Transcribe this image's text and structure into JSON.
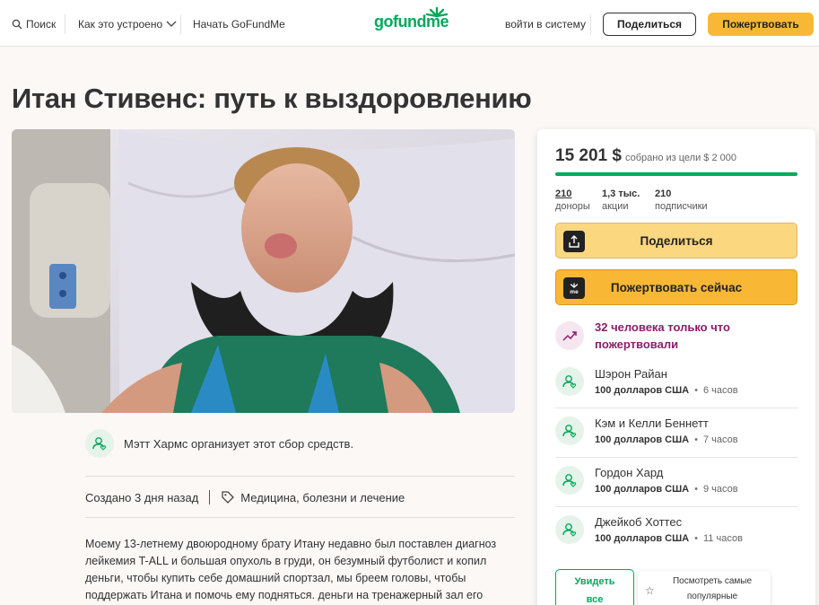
{
  "header": {
    "search": "Поиск",
    "how_it_works": "Как это устроено",
    "start": "Начать GoFundMe",
    "logo": "gofundme",
    "login": "войти в систему",
    "share": "Поделиться",
    "donate": "Пожертвовать"
  },
  "campaign": {
    "title": "Итан Стивенс: путь к выздоровлению",
    "organizer": "Мэтт Хармс организует этот сбор средств.",
    "created": "Создано 3 дня назад",
    "category": "Медицина, болезни и лечение",
    "story": "Моему 13-летнему двоюродному брату Итану недавно был поставлен диагноз лейкемия T-ALL и большая опухоль в груди, он безумный футболист и копил деньги, чтобы купить себе домашний спортзал, мы бреем головы, чтобы поддержать Итана и помочь ему подняться. деньги на тренажерный зал его"
  },
  "sidebar": {
    "raised": "15 201 $",
    "goal_text": "собрано из цели $ 2 000",
    "progress": 1.0,
    "stats": [
      {
        "value": "210",
        "label": "доноры"
      },
      {
        "value": "1,3 тыс.",
        "label": "акции"
      },
      {
        "value": "210",
        "label": "подписчики"
      }
    ],
    "share_btn": "Поделиться",
    "donate_btn": "Пожертвовать сейчас",
    "recent": "32 человека только что пожертвовали",
    "donations": [
      {
        "name": "Шэрон Райан",
        "amount": "100 долларов США",
        "time": "6 часов"
      },
      {
        "name": "Кэм и Келли Беннетт",
        "amount": "100 долларов США",
        "time": "7 часов"
      },
      {
        "name": "Гордон Хард",
        "amount": "100 долларов США",
        "time": "9 часов"
      },
      {
        "name": "Джейкоб Хоттес",
        "amount": "100 долларов США",
        "time": "11 часов"
      }
    ],
    "see_all_1": "Увидеть",
    "see_all_2": "все",
    "top_1": "Посмотреть самые",
    "top_2": "популярные пожертвования"
  },
  "colors": {
    "brand": "#02a95c",
    "accent": "#f8b836",
    "recent": "#8a1e6a"
  }
}
